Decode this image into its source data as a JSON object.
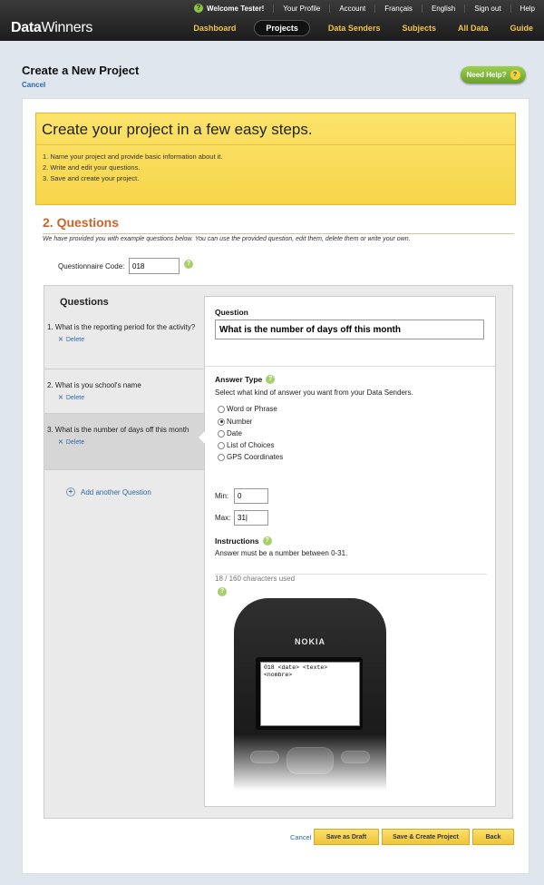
{
  "header": {
    "logo": {
      "part1": "Data",
      "part2": "Winners"
    },
    "utility_links": [
      "Your Profile",
      "Account",
      "Français",
      "English",
      "Sign out",
      "Help"
    ],
    "welcome": "Welcome Tester!",
    "nav": [
      "Dashboard",
      "Projects",
      "Data Senders",
      "Subjects",
      "All Data",
      "Guide"
    ],
    "active_nav": "Projects"
  },
  "page": {
    "title": "Create a New Project",
    "cancel": "Cancel",
    "need_help": "Need Help?",
    "need_help_icon": "?"
  },
  "steps": {
    "title": "Create your project in a few easy steps.",
    "items": [
      "1. Name your project and provide basic information about it.",
      "2. Write and edit your questions.",
      "3. Save and create your project."
    ]
  },
  "section": {
    "title": "2. Questions",
    "description": "We have provided you with example questions below. You can use the provided question, edit them, delete them or write your own.",
    "questionnaire_code_label": "Questionnaire Code:",
    "questionnaire_code_value": "018",
    "help_icon": "?"
  },
  "questions_panel": {
    "title": "Questions",
    "items": [
      {
        "text": "1.  What is the reporting period for the activity?",
        "delete": "Delete"
      },
      {
        "text": "2.  What is you school's name",
        "delete": "Delete"
      },
      {
        "text": "3.  What is the number of days off this month",
        "delete": "Delete"
      }
    ],
    "selected_index": 2,
    "add_label": "Add another Question",
    "add_icon": "+",
    "delete_icon": "✕"
  },
  "question_form": {
    "question_label": "Question",
    "question_value": "What is the number of days off this month",
    "answer_type_label": "Answer Type",
    "answer_type_hint": "Select what kind of answer you want from your Data Senders.",
    "answer_types": [
      "Word or Phrase",
      "Number",
      "Date",
      "List of Choices",
      "GPS Coordinates"
    ],
    "selected_answer_type": "Number",
    "min_label": "Min:",
    "min_value": "0",
    "max_label": "Max:",
    "max_value": "31|",
    "instructions_label": "Instructions",
    "instructions_text": "Answer must be a number between 0-31.",
    "chars_used": "18 / 160 characters used"
  },
  "phone": {
    "brand": "NOKIA",
    "screen_text": "018 <date> <texte>\n<nombre>"
  },
  "footer": {
    "cancel": "Cancel",
    "save_draft": "Save as Draft",
    "save_create": "Save & Create Project",
    "back": "Back"
  }
}
